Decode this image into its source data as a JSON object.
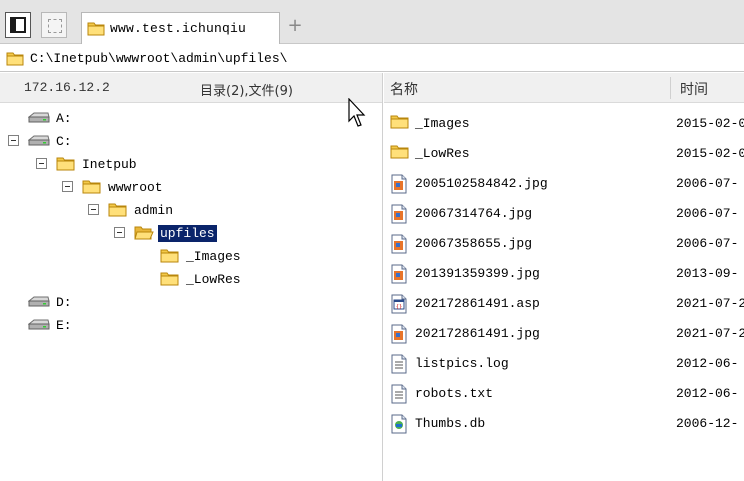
{
  "tab": {
    "title": "www.test.ichunqiu",
    "new_tab": "+"
  },
  "address": {
    "path": "C:\\Inetpub\\wwwroot\\admin\\upfiles\\"
  },
  "left_header": {
    "ip": "172.16.12.2",
    "stats": "目录(2),文件(9)"
  },
  "tree": [
    {
      "label": "A:",
      "type": "drive",
      "expander": false,
      "depth": 0,
      "selected": false
    },
    {
      "label": "C:",
      "type": "drive",
      "expander": true,
      "depth": 0,
      "selected": false
    },
    {
      "label": "Inetpub",
      "type": "folder",
      "expander": true,
      "depth": 1,
      "selected": false
    },
    {
      "label": "wwwroot",
      "type": "folder",
      "expander": true,
      "depth": 2,
      "selected": false
    },
    {
      "label": "admin",
      "type": "folder",
      "expander": true,
      "depth": 3,
      "selected": false
    },
    {
      "label": "upfiles",
      "type": "folder-open",
      "expander": true,
      "depth": 4,
      "selected": true
    },
    {
      "label": "_Images",
      "type": "folder",
      "expander": false,
      "depth": 5,
      "selected": false
    },
    {
      "label": "_LowRes",
      "type": "folder",
      "expander": false,
      "depth": 5,
      "selected": false
    },
    {
      "label": "D:",
      "type": "drive",
      "expander": false,
      "depth": 0,
      "selected": false
    },
    {
      "label": "E:",
      "type": "drive",
      "expander": false,
      "depth": 0,
      "selected": false
    }
  ],
  "columns": {
    "name": "名称",
    "time": "时间"
  },
  "files": [
    {
      "name": "_Images",
      "time": "2015-02-0",
      "icon": "folder-icon"
    },
    {
      "name": "_LowRes",
      "time": "2015-02-0",
      "icon": "folder-icon"
    },
    {
      "name": "2005102584842.jpg",
      "time": "2006-07-",
      "icon": "image-icon"
    },
    {
      "name": "20067314764.jpg",
      "time": "2006-07-",
      "icon": "image-icon"
    },
    {
      "name": "20067358655.jpg",
      "time": "2006-07-",
      "icon": "image-icon"
    },
    {
      "name": "201391359399.jpg",
      "time": "2013-09-",
      "icon": "image-icon"
    },
    {
      "name": "202172861491.asp",
      "time": "2021-07-2",
      "icon": "script-icon"
    },
    {
      "name": "202172861491.jpg",
      "time": "2021-07-2",
      "icon": "image-icon"
    },
    {
      "name": "listpics.log",
      "time": "2012-06-",
      "icon": "text-file-icon"
    },
    {
      "name": "robots.txt",
      "time": "2012-06-",
      "icon": "text-file-icon"
    },
    {
      "name": "Thumbs.db",
      "time": "2006-12-",
      "icon": "db-file-icon"
    }
  ],
  "colors": {
    "selection": "#0a246a",
    "folder": "#f3c94a",
    "header_bg": "#f0f0f0"
  }
}
